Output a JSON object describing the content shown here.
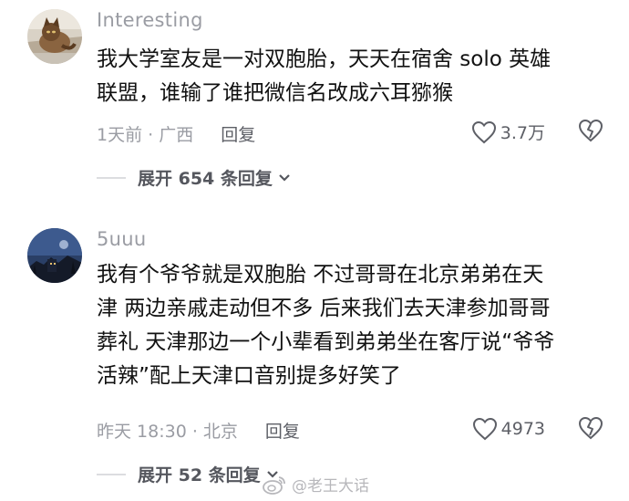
{
  "comments": [
    {
      "username": "Interesting",
      "text": "我大学室友是一对双胞胎，天天在宿舍 solo 英雄\n联盟，谁输了谁把微信名改成六耳猕猴",
      "time_location": "1天前 · 广西",
      "reply_label": "回复",
      "like_count": "3.7万",
      "expand_label": "展开 654 条回复",
      "avatar_icon": "cat-photo-avatar"
    },
    {
      "username": "5uuu",
      "text": "我有个爷爷就是双胞胎 不过哥哥在北京弟弟在天\n津 两边亲戚走动但不多 后来我们去天津参加哥哥\n葬礼 天津那边一个小辈看到弟弟坐在客厅说“爷爷\n活辣”配上天津口音别提多好笑了",
      "time_location": "昨天 18:30 · 北京",
      "reply_label": "回复",
      "like_count": "4973",
      "expand_label": "展开 52 条回复",
      "avatar_icon": "night-scene-avatar"
    }
  ],
  "watermark": {
    "text": "@老王大话",
    "icon": "weibo-logo-icon"
  },
  "colors": {
    "meta_gray": "#9a9ca3",
    "text": "#111111",
    "action_gray": "#5d5f66"
  }
}
